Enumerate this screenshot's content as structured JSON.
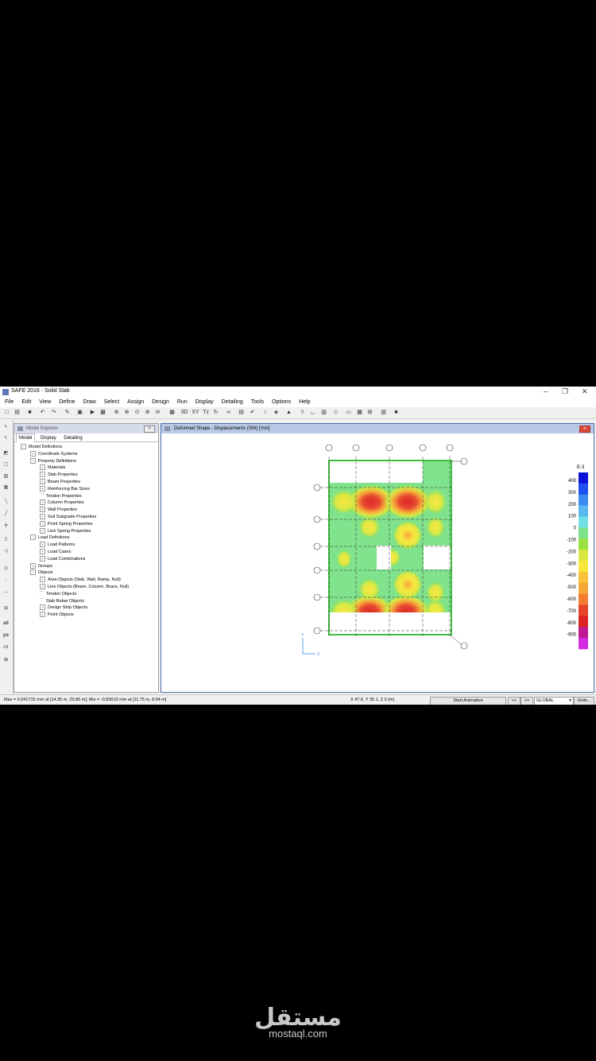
{
  "window": {
    "title": "SAFE 2016 - Solid Slab",
    "controls": [
      "–",
      "❐",
      "✕"
    ]
  },
  "menu": [
    "File",
    "Edit",
    "View",
    "Define",
    "Draw",
    "Select",
    "Assign",
    "Design",
    "Run",
    "Display",
    "Detailing",
    "Tools",
    "Options",
    "Help"
  ],
  "toolbar": {
    "labels": {
      "three_d": "3D",
      "xy": "XY",
      "tz": "Tz"
    }
  },
  "sidebar_tools": [
    "all",
    "ps",
    "clr"
  ],
  "explorer": {
    "title": "Model Explorer",
    "tabs": [
      "Model",
      "Display",
      "Detailing"
    ],
    "tree": [
      {
        "label": "Model Definitions",
        "level": 0,
        "type": "minus"
      },
      {
        "label": "Coordinate Systems",
        "level": 1,
        "type": "plus"
      },
      {
        "label": "Property Definitions",
        "level": 1,
        "type": "minus"
      },
      {
        "label": "Materials",
        "level": 2,
        "type": "plus"
      },
      {
        "label": "Slab Properties",
        "level": 2,
        "type": "plus"
      },
      {
        "label": "Beam Properties",
        "level": 2,
        "type": "plus"
      },
      {
        "label": "Reinforcing Bar Sizes",
        "level": 2,
        "type": "plus"
      },
      {
        "label": "Tendon Properties",
        "level": 2,
        "type": "leaf"
      },
      {
        "label": "Column Properties",
        "level": 2,
        "type": "plus"
      },
      {
        "label": "Wall Properties",
        "level": 2,
        "type": "plus"
      },
      {
        "label": "Soil Subgrade Properties",
        "level": 2,
        "type": "plus"
      },
      {
        "label": "Point Spring Properties",
        "level": 2,
        "type": "plus"
      },
      {
        "label": "Line Spring Properties",
        "level": 2,
        "type": "plus"
      },
      {
        "label": "Load Definitions",
        "level": 1,
        "type": "minus"
      },
      {
        "label": "Load Patterns",
        "level": 2,
        "type": "plus"
      },
      {
        "label": "Load Cases",
        "level": 2,
        "type": "plus"
      },
      {
        "label": "Load Combinations",
        "level": 2,
        "type": "plus"
      },
      {
        "label": "Groups",
        "level": 1,
        "type": "plus"
      },
      {
        "label": "Objects",
        "level": 1,
        "type": "minus"
      },
      {
        "label": "Area Objects (Slab, Wall, Ramp, Null)",
        "level": 2,
        "type": "plus"
      },
      {
        "label": "Line Objects (Beam, Column, Brace, Null)",
        "level": 2,
        "type": "plus"
      },
      {
        "label": "Tendon Objects",
        "level": 2,
        "type": "leaf"
      },
      {
        "label": "Slab Rebar Objects",
        "level": 2,
        "type": "leaf"
      },
      {
        "label": "Design Strip Objects",
        "level": 2,
        "type": "plus"
      },
      {
        "label": "Point Objects",
        "level": 2,
        "type": "plus"
      }
    ]
  },
  "viewer": {
    "title": "Deformed Shape - Displacements (SW)  [mm]",
    "legend": {
      "exponent": "E-3",
      "labels": [
        "400",
        "300",
        "200",
        "100",
        "0",
        "-100",
        "-200",
        "-300",
        "-400",
        "-500",
        "-600",
        "-700",
        "-800",
        "-900"
      ],
      "colors": [
        "#0a14d8",
        "#1e50f0",
        "#3a8cf0",
        "#5ab8ee",
        "#70e0e6",
        "#7de28a",
        "#9ae040",
        "#d8e840",
        "#f8e63c",
        "#f8c23a",
        "#f6a636",
        "#f27c30",
        "#e6432a",
        "#dc2424",
        "#c01890",
        "#d22ce0"
      ]
    },
    "axis_labels": {
      "x": "X",
      "y": "Y"
    }
  },
  "status": {
    "minmax": "Max = 0.041715 mm at [14.35 m, 29.85 m];  Min = -0.83012 mm at [11.75 m, 8.94 m]",
    "coords": "X 47.6,  Y 35.1,  Z 0  (m)",
    "animation": "Start Animation",
    "prev": "<<",
    "next": ">>",
    "coord_system": "GLOBAL",
    "units": "Units..."
  },
  "watermark": {
    "arabic": "مستقل",
    "latin": "mostaql.com"
  }
}
